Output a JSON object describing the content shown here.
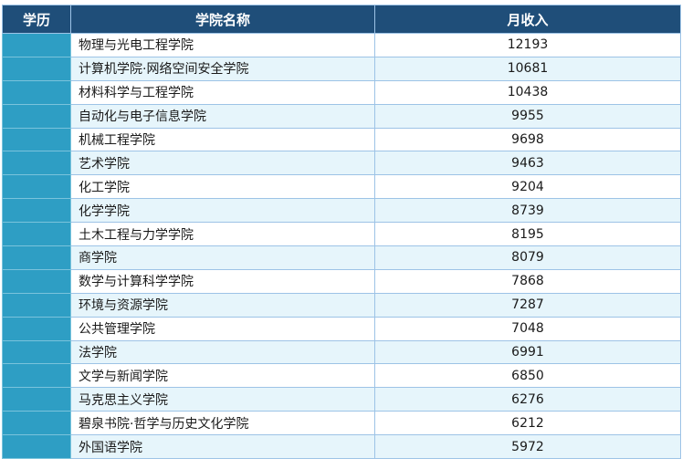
{
  "table": {
    "headers": {
      "degree": "学历",
      "college": "学院名称",
      "income": "月收入"
    },
    "rows": [
      {
        "degree": "",
        "college": "物理与光电工程学院",
        "income": "12193"
      },
      {
        "degree": "",
        "college": "计算机学院·网络空间安全学院",
        "income": "10681"
      },
      {
        "degree": "",
        "college": "材料科学与工程学院",
        "income": "10438"
      },
      {
        "degree": "",
        "college": "自动化与电子信息学院",
        "income": "9955"
      },
      {
        "degree": "",
        "college": "机械工程学院",
        "income": "9698"
      },
      {
        "degree": "",
        "college": "艺术学院",
        "income": "9463"
      },
      {
        "degree": "",
        "college": "化工学院",
        "income": "9204"
      },
      {
        "degree": "",
        "college": "化学学院",
        "income": "8739"
      },
      {
        "degree": "",
        "college": "土木工程与力学学院",
        "income": "8195"
      },
      {
        "degree": "",
        "college": "商学院",
        "income": "8079"
      },
      {
        "degree": "",
        "college": "数学与计算科学学院",
        "income": "7868"
      },
      {
        "degree": "",
        "college": "环境与资源学院",
        "income": "7287"
      },
      {
        "degree": "",
        "college": "公共管理学院",
        "income": "7048"
      },
      {
        "degree": "",
        "college": "法学院",
        "income": "6991"
      },
      {
        "degree": "",
        "college": "文学与新闻学院",
        "income": "6850"
      },
      {
        "degree": "",
        "college": "马克思主义学院",
        "income": "6276"
      },
      {
        "degree": "",
        "college": "碧泉书院·哲学与历史文化学院",
        "income": "6212"
      },
      {
        "degree": "",
        "college": "外国语学院",
        "income": "5972"
      }
    ]
  },
  "colors": {
    "header_bg": "#1f4e79",
    "degree_cell": "#2e9ec4",
    "row_alt": "#e6f5fb",
    "border": "#9dc3e6"
  }
}
